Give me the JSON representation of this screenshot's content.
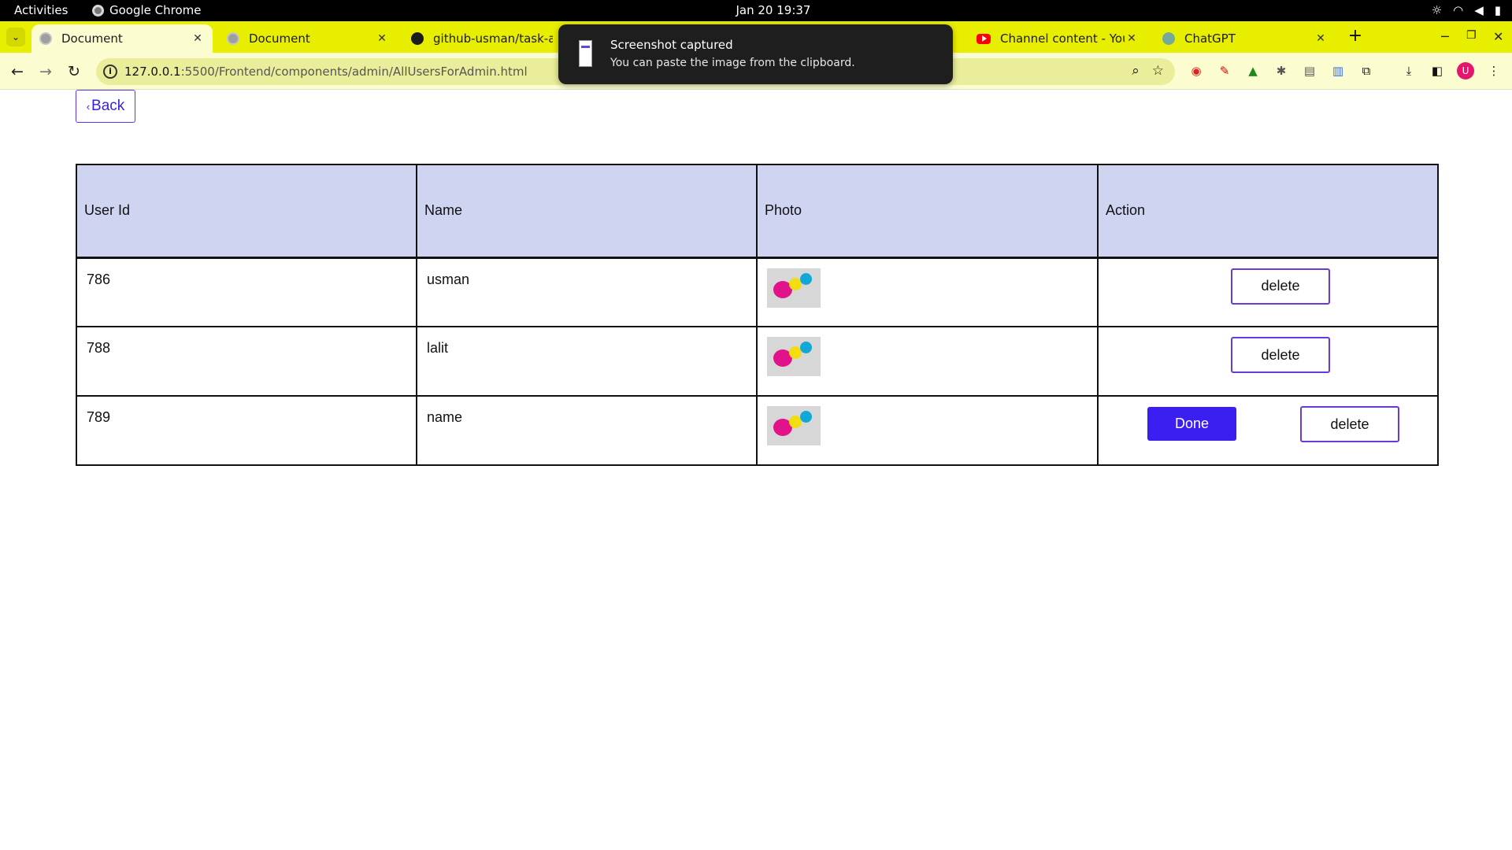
{
  "os_bar": {
    "activities": "Activities",
    "app_name": "Google Chrome",
    "clock": "Jan 20  19:37"
  },
  "tabs": [
    {
      "title": "Document",
      "favicon": "globe-icon",
      "active": true
    },
    {
      "title": "Document",
      "favicon": "globe-icon",
      "active": false
    },
    {
      "title": "github-usman/task-adm",
      "favicon": "github-icon",
      "active": false
    },
    {
      "title": "Channel content - YouTu",
      "favicon": "youtube-icon",
      "active": false
    },
    {
      "title": "ChatGPT",
      "favicon": "chatgpt-icon",
      "active": false
    }
  ],
  "address_bar": {
    "host": "127.0.0.1",
    "path": ":5500/Frontend/components/admin/AllUsersForAdmin.html"
  },
  "toast": {
    "title": "Screenshot captured",
    "message": "You can paste the image from the clipboard."
  },
  "page": {
    "back_label": "Back",
    "table": {
      "columns": [
        "User Id",
        "Name",
        "Photo",
        "Action"
      ],
      "rows": [
        {
          "id": "786",
          "name": "usman",
          "show_done": false
        },
        {
          "id": "788",
          "name": "lalit",
          "show_done": false
        },
        {
          "id": "789",
          "name": "name",
          "show_done": true
        }
      ],
      "delete_label": "delete",
      "done_label": "Done"
    }
  },
  "colors": {
    "tab_strip": "#e8ee00",
    "header_bg": "#cfd5f1",
    "done_button": "#3b1ff2",
    "delete_border": "#6a3ad8",
    "profile_avatar": "#e4166e"
  },
  "profile_initial": "U"
}
